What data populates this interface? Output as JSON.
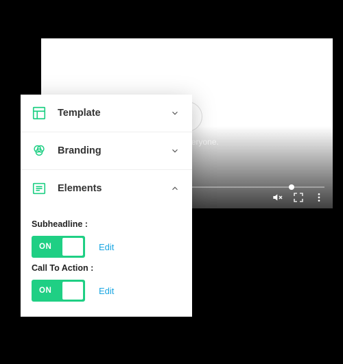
{
  "colors": {
    "accent": "#1fcf84",
    "link": "#1aa6e2"
  },
  "video": {
    "overlay_text": "BS, for everyone."
  },
  "panel": {
    "rows": [
      {
        "label": "Template",
        "expanded": false
      },
      {
        "label": "Branding",
        "expanded": false
      },
      {
        "label": "Elements",
        "expanded": true
      }
    ],
    "elements_body": {
      "subheadline": {
        "label": "Subheadline :",
        "state_label": "ON",
        "edit_label": "Edit"
      },
      "cta": {
        "label": "Call To Action :",
        "state_label": "ON",
        "edit_label": "Edit"
      }
    }
  }
}
